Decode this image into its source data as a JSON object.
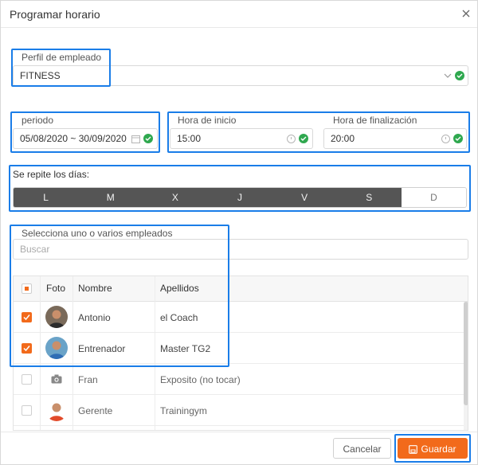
{
  "dialog": {
    "title": "Programar horario"
  },
  "profile": {
    "label": "Perfil de empleado",
    "value": "FITNESS"
  },
  "period": {
    "label": "periodo",
    "value": "05/08/2020 ~ 30/09/2020"
  },
  "start_time": {
    "label": "Hora de inicio",
    "value": "15:00"
  },
  "end_time": {
    "label": "Hora de finalización",
    "value": "20:00"
  },
  "repeat": {
    "label": "Se repite los días:",
    "days": [
      {
        "label": "L",
        "selected": true
      },
      {
        "label": "M",
        "selected": true
      },
      {
        "label": "X",
        "selected": true
      },
      {
        "label": "J",
        "selected": true
      },
      {
        "label": "V",
        "selected": true
      },
      {
        "label": "S",
        "selected": true
      },
      {
        "label": "D",
        "selected": false
      }
    ]
  },
  "employees": {
    "label": "Selecciona uno o varios empleados",
    "search_placeholder": "Buscar",
    "columns": {
      "photo": "Foto",
      "name": "Nombre",
      "surname": "Apellidos"
    },
    "rows": [
      {
        "name": "Antonio",
        "surname": "el Coach",
        "checked": true,
        "photo": "avatar"
      },
      {
        "name": "Entrenador",
        "surname": "Master TG2",
        "checked": true,
        "photo": "avatar"
      },
      {
        "name": "Fran",
        "surname": "Exposito (no tocar)",
        "checked": false,
        "photo": "camera-icon"
      },
      {
        "name": "Gerente",
        "surname": "Trainingym",
        "checked": false,
        "photo": "avatar"
      }
    ]
  },
  "footer": {
    "cancel_label": "Cancelar",
    "save_label": "Guardar"
  },
  "colors": {
    "accent": "#f26a1b",
    "highlight": "#1a7de8",
    "success": "#2fa84f",
    "day_selected": "#555555"
  }
}
